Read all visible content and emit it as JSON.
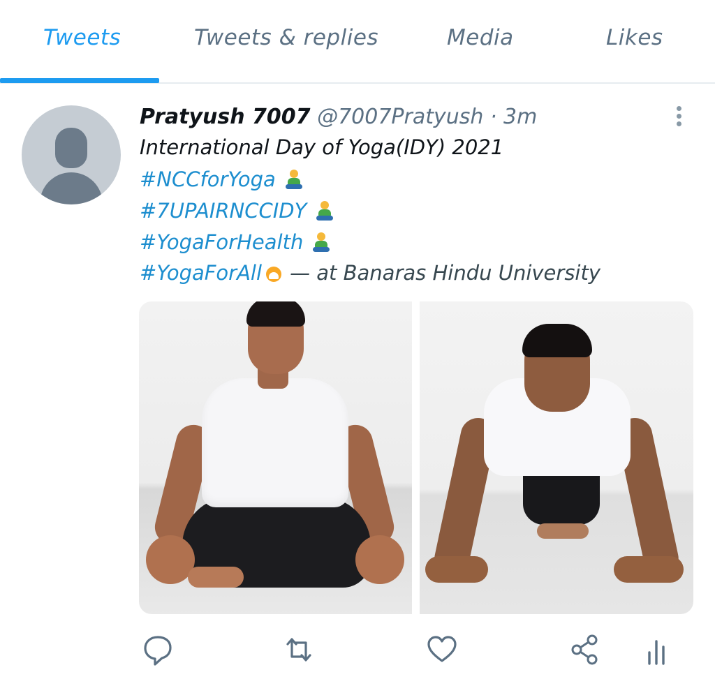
{
  "tabs": {
    "items": [
      {
        "label": "Tweets",
        "active": true
      },
      {
        "label": "Tweets & replies",
        "active": false
      },
      {
        "label": "Media",
        "active": false
      },
      {
        "label": "Likes",
        "active": false
      }
    ]
  },
  "tweet": {
    "author_name": "Pratyush 7007",
    "handle": "@7007Pratyush",
    "separator": "·",
    "time": "3m",
    "text": "International Day of Yoga(IDY) 2021",
    "hashtags": [
      "#NCCforYoga",
      "#7UPAIRNCCIDY",
      "#YogaForHealth",
      "#YogaForAll"
    ],
    "location": "— at Banaras Hindu University",
    "emoji_icons": [
      "person-in-lotus-position-icon",
      "person-in-lotus-position-icon",
      "person-in-lotus-position-icon",
      "yoga-day-logo-icon"
    ],
    "media_count": 2
  },
  "actions": {
    "icons": [
      "reply-icon",
      "retweet-icon",
      "like-icon",
      "share-icon",
      "analytics-icon"
    ]
  },
  "colors": {
    "accent": "#1d9bf0",
    "hashtag": "#1d8ecf",
    "muted": "#5b7083"
  }
}
